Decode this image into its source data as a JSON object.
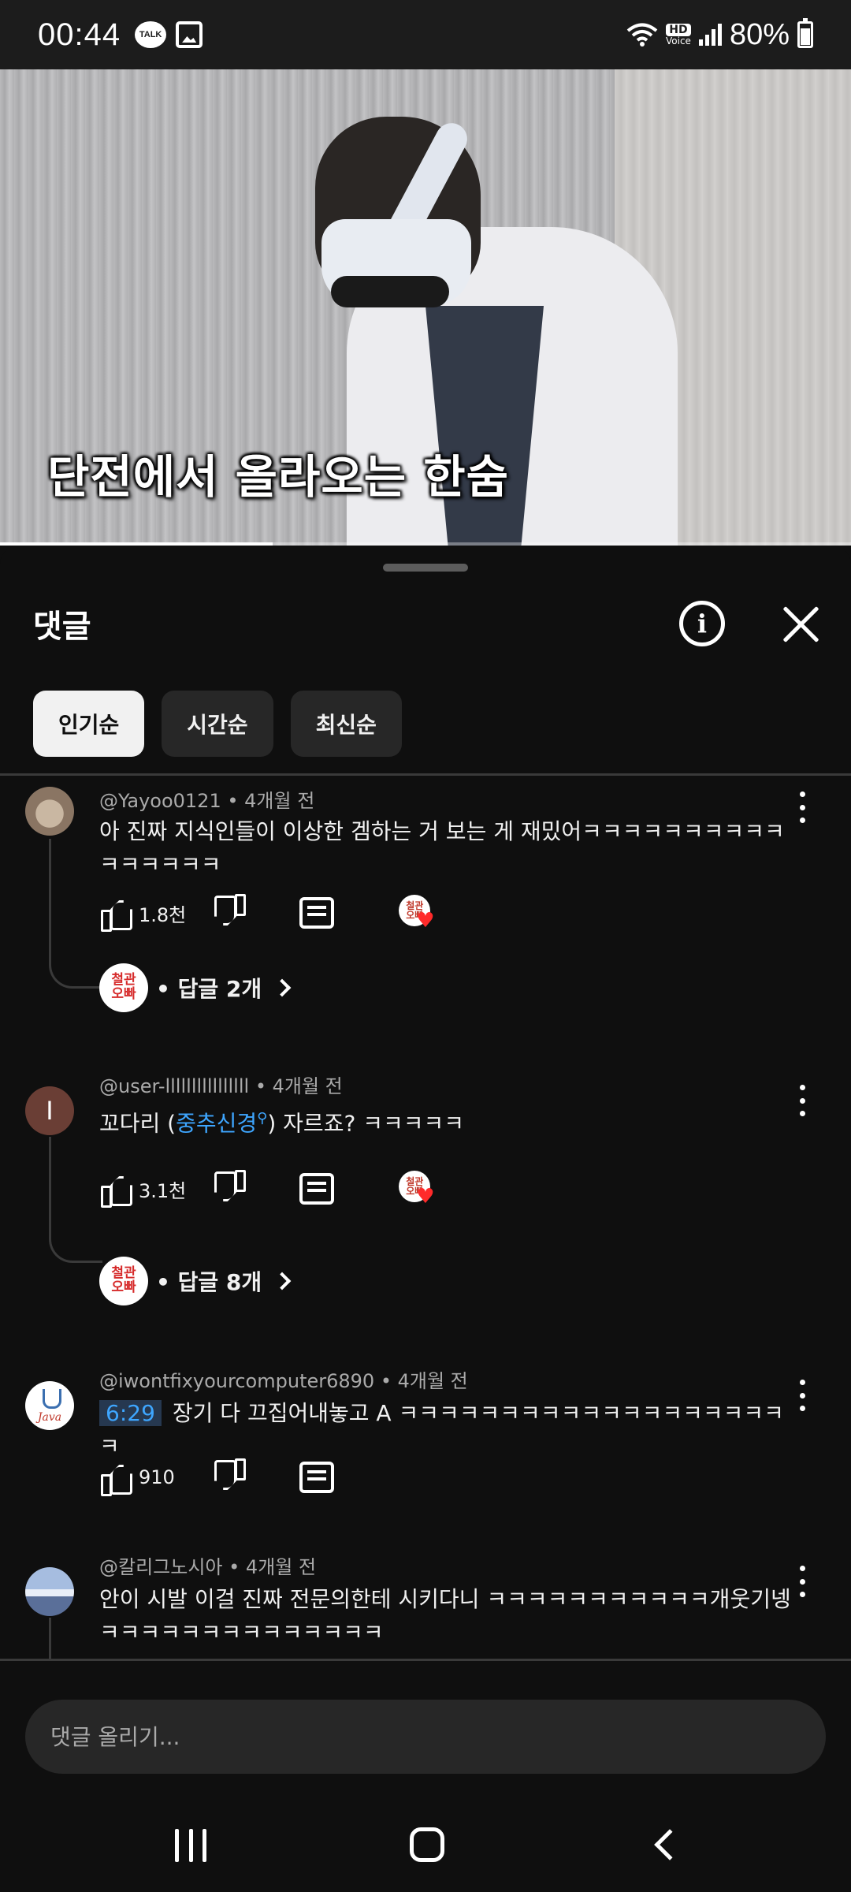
{
  "status_bar": {
    "time": "00:44",
    "talk_label": "TALK",
    "hd_label": "HD",
    "voice_label": "Voice",
    "battery": "80%"
  },
  "video": {
    "subtitle": "단전에서 올라오는 한숨",
    "progress_fraction": 0.32
  },
  "comments_panel": {
    "title": "댓글",
    "sort_chips": [
      {
        "label": "인기순",
        "active": true
      },
      {
        "label": "시간순",
        "active": false
      },
      {
        "label": "최신순",
        "active": false
      }
    ],
    "comments": [
      {
        "author": "@Yayoo0121",
        "time": "4개월 전",
        "text": "아 진짜 지식인들이 이상한 겜하는 거 보는 게 재밌어ㅋㅋㅋㅋㅋㅋㅋㅋㅋㅋㅋㅋㅋㅋㅋㅋ",
        "likes": "1.8천",
        "creator_heart": true,
        "replies": "• 답글 2개"
      },
      {
        "author": "@user-llllllllllllllll",
        "avatar_letter": "I",
        "time": "4개월 전",
        "text_before": "꼬다리 (",
        "text_link": "중추신경",
        "text_after": ") 자르죠? ㅋㅋㅋㅋㅋ",
        "likes": "3.1천",
        "creator_heart": true,
        "replies": "• 답글 8개"
      },
      {
        "author": "@iwontfixyourcomputer6890",
        "avatar_label": "Java",
        "time": "4개월 전",
        "timestamp": "6:29",
        "text": "장기 다 끄집어내놓고 A ㅋㅋㅋㅋㅋㅋㅋㅋㅋㅋㅋㅋㅋㅋㅋㅋㅋㅋㅋㅋ",
        "likes": "910",
        "creator_heart": false
      },
      {
        "author": "@칼리그노시아",
        "time": "4개월 전",
        "text": "안이 시발 이걸 진짜 전문의한테 시키다니 ㅋㅋㅋㅋㅋㅋㅋㅋㅋㅋㅋ개웃기넹ㅋㅋㅋㅋㅋㅋㅋㅋㅋㅋㅋㅋㅋㅋ"
      }
    ],
    "creator_badge": "철관\n오빠",
    "input_placeholder": "댓글 올리기..."
  },
  "colors": {
    "background": "#0f0f0f",
    "chip_active": "#f1f1f1",
    "chip_inactive": "#272727",
    "link": "#3ea6ff",
    "heart": "#ff2a2a"
  },
  "icons": [
    "talk-icon",
    "photo-icon",
    "wifi-icon",
    "signal-icon",
    "battery-icon",
    "info-icon",
    "close-icon",
    "like-icon",
    "dislike-icon",
    "reply-icon",
    "more-icon",
    "chevron-right-icon",
    "recent-apps-icon",
    "home-icon",
    "back-icon"
  ]
}
